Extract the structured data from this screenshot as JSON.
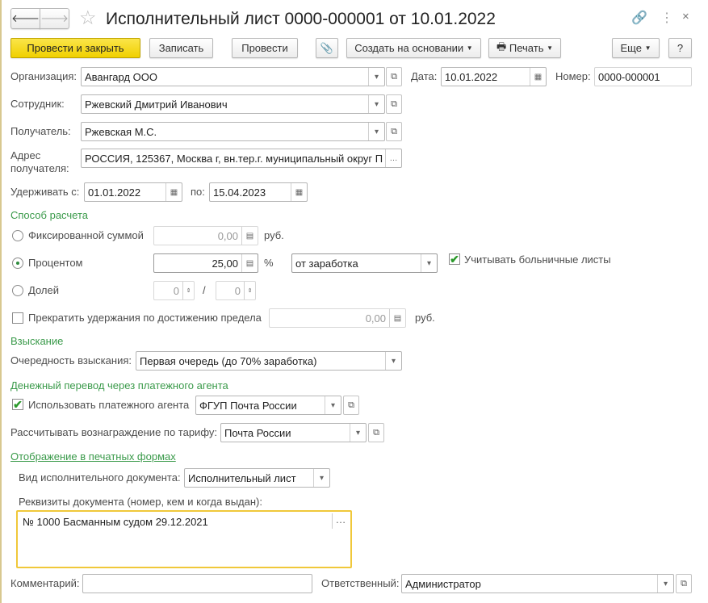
{
  "title": "Исполнительный лист 0000-000001 от 10.01.2022",
  "toolbar": {
    "post_close": "Провести и закрыть",
    "save": "Записать",
    "post": "Провести",
    "create_based": "Создать на основании",
    "print": "Печать",
    "more": "Еще",
    "help": "?"
  },
  "header": {
    "org_label": "Организация:",
    "org": "Авангард ООО",
    "date_label": "Дата:",
    "date": "10.01.2022",
    "number_label": "Номер:",
    "number": "0000-000001"
  },
  "employee_label": "Сотрудник:",
  "employee": "Ржевский Дмитрий Иванович",
  "recipient_label": "Получатель:",
  "recipient": "Ржевская М.С.",
  "address_label_1": "Адрес",
  "address_label_2": "получателя:",
  "address": "РОССИЯ, 125367, Москва г, вн.тер.г. муниципальный округ П",
  "hold_from_label": "Удерживать с:",
  "hold_from": "01.01.2022",
  "hold_to_label": "по:",
  "hold_to": "15.04.2023",
  "calc": {
    "heading": "Способ расчета",
    "fixed_label": "Фиксированной суммой",
    "fixed_value": "0,00",
    "rub": "руб.",
    "percent_label": "Процентом",
    "percent_value": "25,00",
    "percent_sign": "%",
    "percent_base": "от заработка",
    "sick_label": "Учитывать больничные листы",
    "sick_checked": true,
    "share_label": "Долей",
    "share_num": "0",
    "share_sep": "/",
    "share_den": "0",
    "selected": "percent",
    "limit_label": "Прекратить удержания по достижению предела",
    "limit_checked": false,
    "limit_value": "0,00"
  },
  "recovery": {
    "heading": "Взыскание",
    "priority_label": "Очередность взыскания:",
    "priority": "Первая очередь (до 70% заработка)"
  },
  "transfer": {
    "heading": "Денежный перевод через платежного агента",
    "use_agent_label": "Использовать платежного агента",
    "use_agent_checked": true,
    "agent": "ФГУП Почта России",
    "tariff_label": "Рассчитывать вознаграждение по тарифу:",
    "tariff": "Почта России"
  },
  "print": {
    "link": "Отображение в печатных формах",
    "doc_type_label": "Вид исполнительного документа:",
    "doc_type": "Исполнительный лист",
    "details_label": "Реквизиты документа (номер, кем и когда выдан):",
    "details": "№ 1000 Басманным судом 29.12.2021"
  },
  "footer": {
    "comment_label": "Комментарий:",
    "comment": "",
    "responsible_label": "Ответственный:",
    "responsible": "Администратор"
  },
  "colors": {
    "accent": "#f0d000",
    "section": "#3a9a4a"
  }
}
